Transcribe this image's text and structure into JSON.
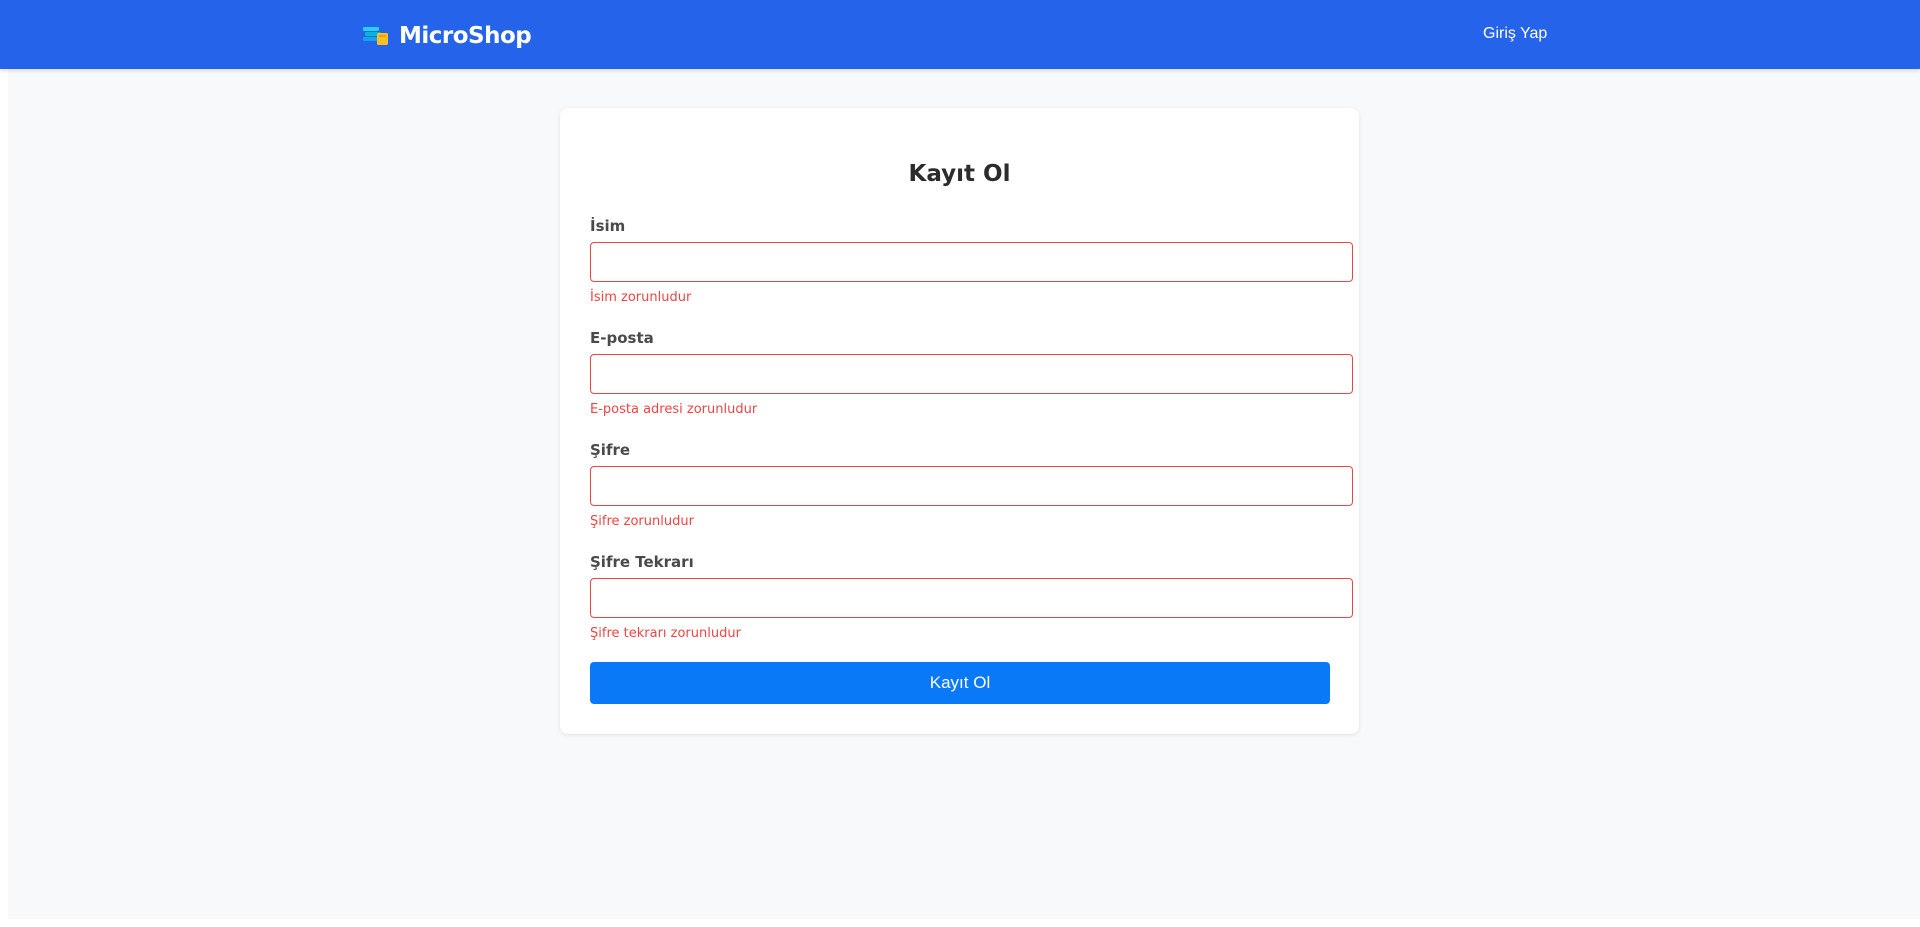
{
  "navbar": {
    "brand": "MicroShop",
    "brand_icon": "stacked-books-icon",
    "login_link": "Giriş Yap",
    "background_color": "#2563eb"
  },
  "register_form": {
    "title": "Kayıt Ol",
    "fields": [
      {
        "label": "İsim",
        "value": "",
        "error": "İsim zorunludur"
      },
      {
        "label": "E-posta",
        "value": "",
        "error": "E-posta adresi zorunludur"
      },
      {
        "label": "Şifre",
        "value": "",
        "error": "Şifre zorunludur"
      },
      {
        "label": "Şifre Tekrarı",
        "value": "",
        "error": "Şifre tekrarı zorunludur"
      }
    ],
    "submit_label": "Kayıt Ol",
    "submit_color": "#0a79f8",
    "error_color": "#ef4444"
  }
}
